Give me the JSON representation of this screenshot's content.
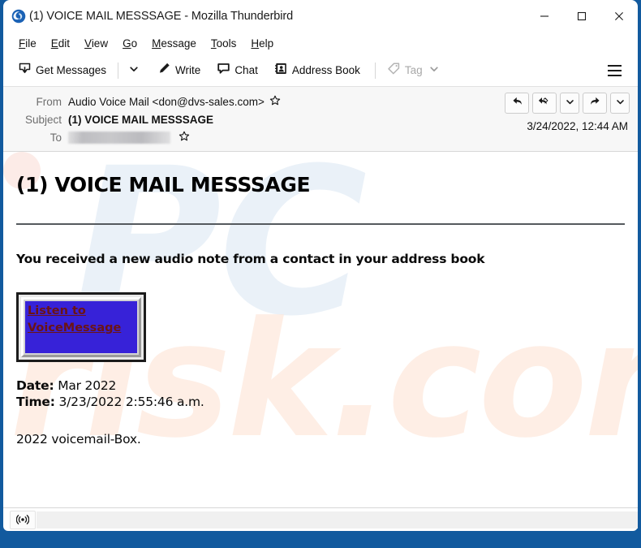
{
  "window": {
    "title": "(1) VOICE MAIL MESSSAGE - Mozilla Thunderbird",
    "logo_icon": "thunderbird-logo-icon",
    "controls": {
      "minimize": "minimize-icon",
      "maximize": "maximize-icon",
      "close": "close-icon"
    },
    "frame_color": "#125a9e"
  },
  "menubar": {
    "items": [
      {
        "label": "File",
        "accel": "F"
      },
      {
        "label": "Edit",
        "accel": "E"
      },
      {
        "label": "View",
        "accel": "V"
      },
      {
        "label": "Go",
        "accel": "G"
      },
      {
        "label": "Message",
        "accel": "M"
      },
      {
        "label": "Tools",
        "accel": "T"
      },
      {
        "label": "Help",
        "accel": "H"
      }
    ]
  },
  "toolbar": {
    "get_messages_label": "Get Messages",
    "get_messages_icon": "inbox-download-icon",
    "get_messages_caret_icon": "chevron-down-icon",
    "write_label": "Write",
    "write_icon": "pencil-icon",
    "chat_label": "Chat",
    "chat_icon": "speech-bubble-icon",
    "address_book_label": "Address Book",
    "address_book_icon": "address-book-icon",
    "tag_label": "Tag",
    "tag_icon": "tag-icon",
    "tag_caret_icon": "chevron-down-icon",
    "tag_disabled": true,
    "app_menu_icon": "hamburger-menu-icon"
  },
  "message_header": {
    "from_label": "From",
    "from_value": "Audio Voice Mail <don@dvs-sales.com>",
    "from_star_icon": "star-icon",
    "subject_label": "Subject",
    "subject_value": "(1) VOICE MAIL MESSSAGE",
    "to_label": "To",
    "to_value": "",
    "to_redacted": true,
    "to_star_icon": "star-icon",
    "date": "3/24/2022, 12:44 AM",
    "actions": [
      {
        "name": "reply-button",
        "icon": "reply-arrow-icon"
      },
      {
        "name": "reply-all-button",
        "icon": "reply-all-arrow-icon"
      },
      {
        "name": "reply-options-button",
        "icon": "chevron-down-icon"
      },
      {
        "name": "forward-button",
        "icon": "forward-arrow-icon"
      },
      {
        "name": "more-options-button",
        "icon": "chevron-down-icon"
      }
    ]
  },
  "message_body": {
    "title": "(1) VOICE MAIL MESSSAGE",
    "lede": "You received a new audio note from a contact in your address book",
    "attachment": {
      "link_text": "Listen to VoiceMessage",
      "background_color": "#3722d8",
      "link_color": "#6b1414"
    },
    "date_key": "Date:",
    "date_value": "Mar 2022",
    "time_key": "Time:",
    "time_value": "3/23/2022 2:55:46 a.m.",
    "footer": "2022 voicemail-Box.",
    "watermark_primary": "PC",
    "watermark_secondary": "risk.com"
  },
  "statusbar": {
    "connection_icon": "broadcast-online-icon"
  }
}
